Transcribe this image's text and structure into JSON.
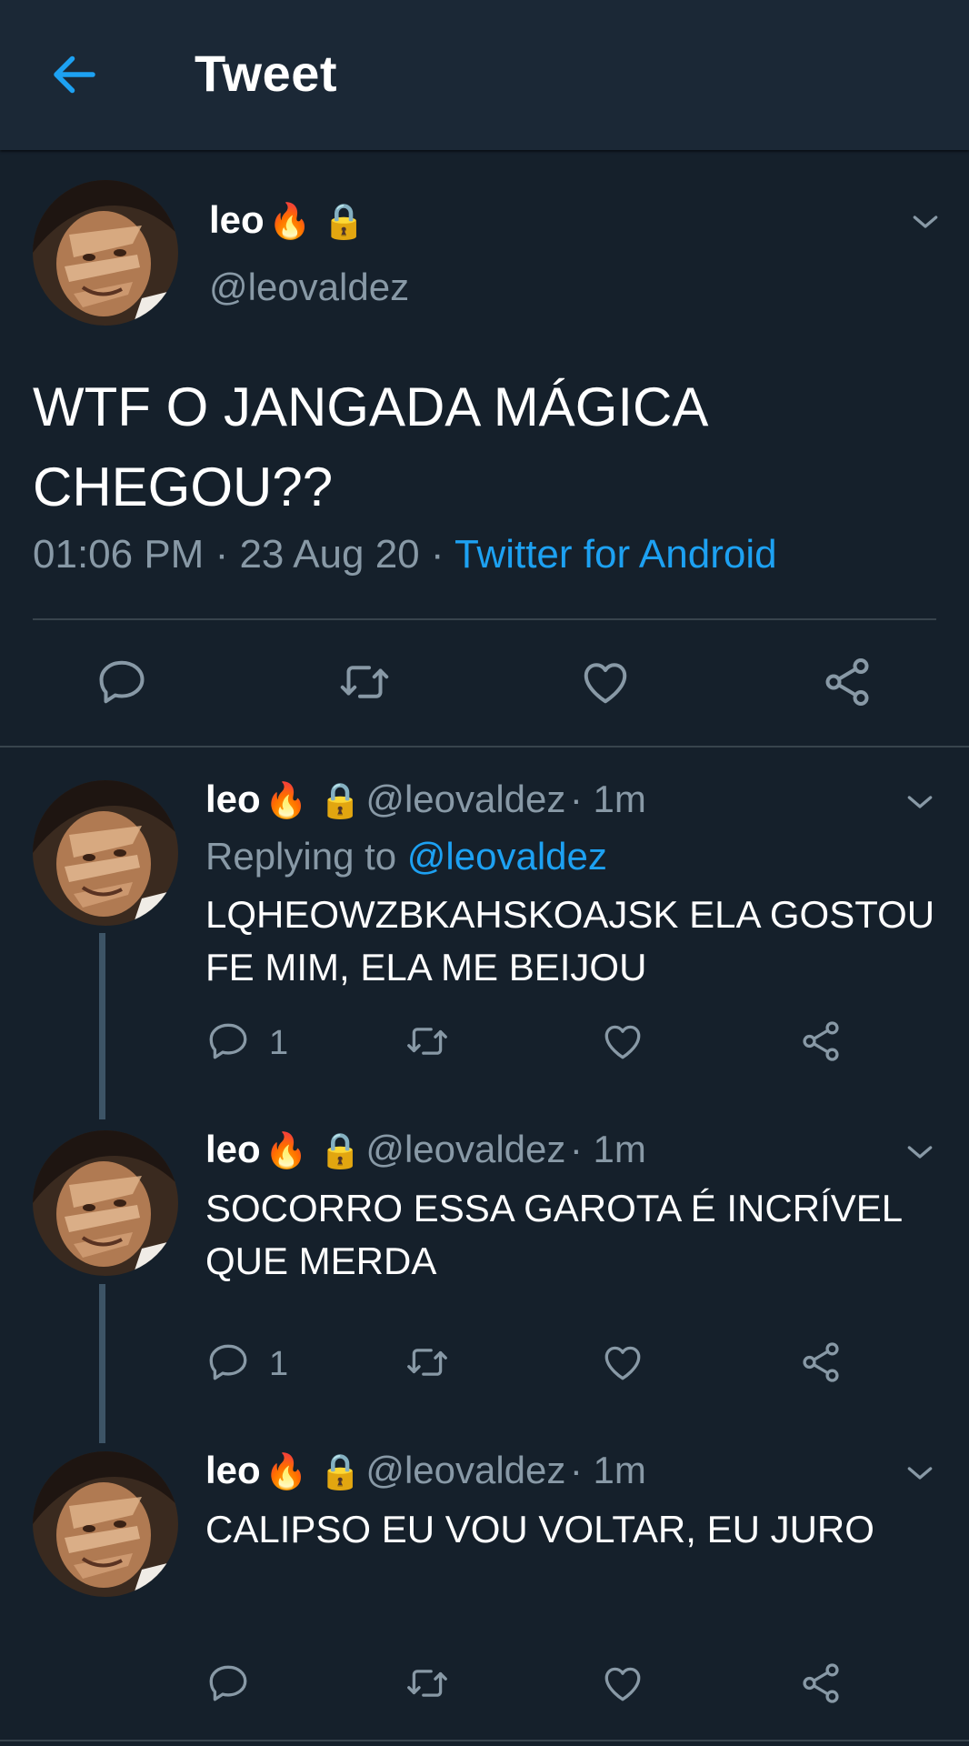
{
  "header": {
    "title": "Tweet"
  },
  "main_tweet": {
    "name": "leo",
    "emojis": "🔥 🔒",
    "handle": "@leovaldez",
    "text_line1": "WTF O JANGADA MÁGICA",
    "text_line2": "CHEGOU??",
    "time": "01:06 PM",
    "sep1": " · ",
    "date": "23 Aug 20",
    "sep2": " · ",
    "source": "Twitter for Android"
  },
  "replies": [
    {
      "name": "leo",
      "emojis": "🔥 🔒",
      "handle": "@leovaldez",
      "age": "· 1m",
      "replying_prefix": "Replying to ",
      "replying_to": "@leovaldez",
      "line1": "LQHEOWZBKAHSKOAJSK ELA GOSTOU",
      "line2": "FE MIM, ELA ME BEIJOU",
      "reply_count": "1"
    },
    {
      "name": "leo",
      "emojis": "🔥 🔒",
      "handle": "@leovaldez",
      "age": "· 1m",
      "line1": "SOCORRO ESSA GAROTA É INCRÍVEL",
      "line2": "QUE MERDA",
      "reply_count": "1"
    },
    {
      "name": "leo",
      "emojis": "🔥 🔒",
      "handle": "@leovaldez",
      "age": "· 1m",
      "line1": "CALIPSO EU VOU VOLTAR, EU JURO"
    }
  ],
  "colors": {
    "background": "#15202b",
    "header": "#1b2836",
    "accent": "#1da1f2",
    "secondary_text": "#8899a6",
    "divider": "#38444d"
  },
  "icons": {
    "back": "arrow-left-icon",
    "more": "chevron-down-icon",
    "reply": "speech-bubble-icon",
    "retweet": "retweet-icon",
    "like": "heart-icon",
    "share": "share-icon"
  }
}
